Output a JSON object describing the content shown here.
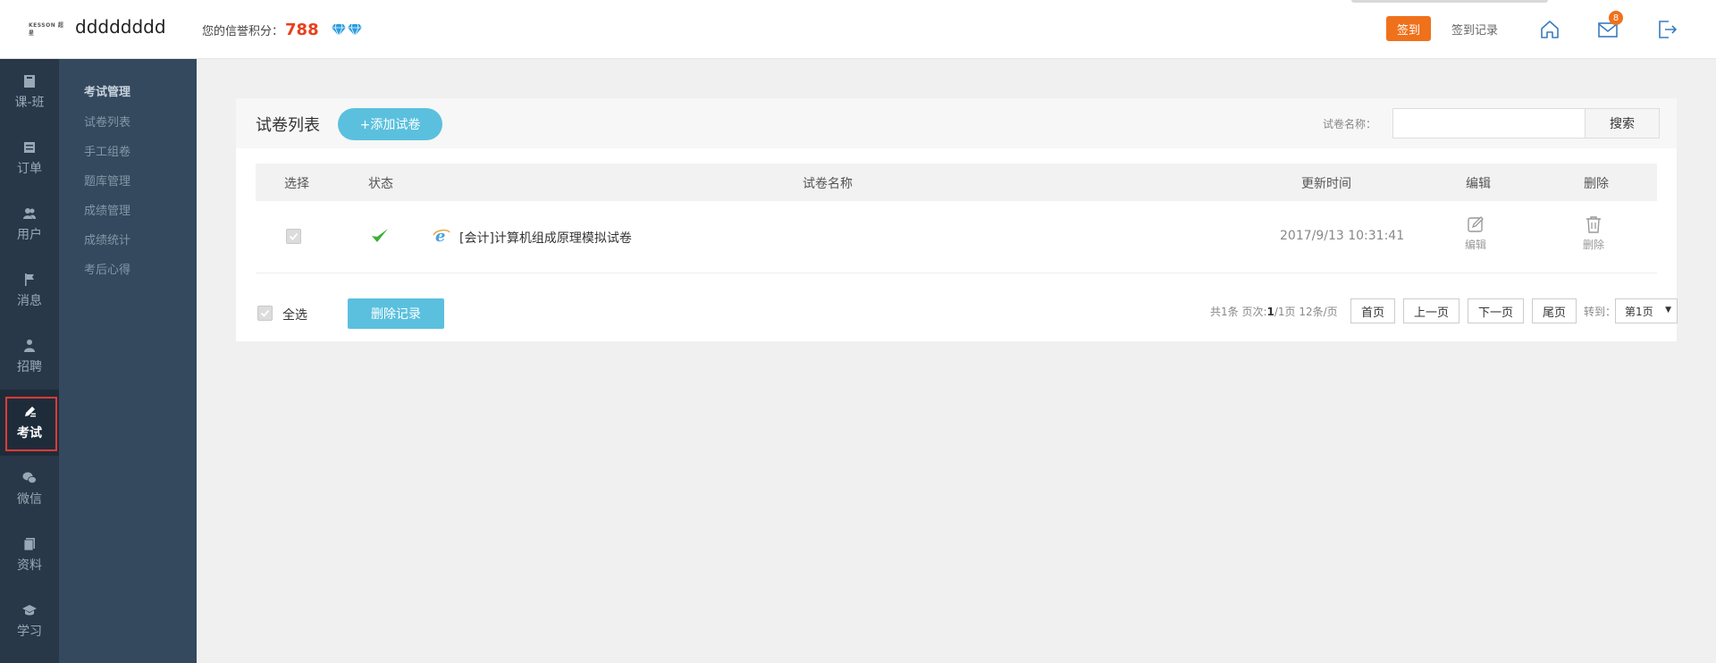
{
  "header": {
    "logo_text": "KESSON 超星",
    "username": "dddddddd",
    "credit_label": "您的信誉积分：",
    "credit_value": "788",
    "sign_label": "签到",
    "sign_record_label": "签到记录",
    "mail_badge": "8"
  },
  "rail": {
    "items": [
      {
        "label": "课-班",
        "icon": "book-icon"
      },
      {
        "label": "订单",
        "icon": "order-icon"
      },
      {
        "label": "用户",
        "icon": "users-icon"
      },
      {
        "label": "消息",
        "icon": "flag-icon"
      },
      {
        "label": "招聘",
        "icon": "recruit-icon"
      },
      {
        "label": "考试",
        "icon": "pencil-icon"
      },
      {
        "label": "微信",
        "icon": "wechat-icon"
      },
      {
        "label": "资料",
        "icon": "docs-icon"
      },
      {
        "label": "学习",
        "icon": "graduation-icon"
      }
    ],
    "active": "考试"
  },
  "subnav": {
    "title": "考试管理",
    "items": [
      "试卷列表",
      "手工组卷",
      "题库管理",
      "成绩管理",
      "成绩统计",
      "考后心得"
    ]
  },
  "panel": {
    "title": "试卷列表",
    "add_label": "+添加试卷",
    "search_label": "试卷名称：",
    "search_value": "",
    "search_button": "搜索"
  },
  "table": {
    "columns": [
      "选择",
      "状态",
      "试卷名称",
      "更新时间",
      "编辑",
      "删除"
    ],
    "rows": [
      {
        "name": "[会计]计算机组成原理模拟试卷",
        "updated": "2017/9/13 10:31:41",
        "edit_label": "编辑",
        "delete_label": "删除"
      }
    ]
  },
  "footer": {
    "select_all_label": "全选",
    "delete_records_label": "删除记录",
    "total_prefix": "共1条 页次:",
    "page_current": "1",
    "page_rest": "/1页 12条/页",
    "first": "首页",
    "prev": "上一页",
    "next": "下一页",
    "last": "尾页",
    "goto_label": "转到：",
    "goto_value": "第1页"
  },
  "colors": {
    "accent": "#5bc0de",
    "sign": "#f0711b",
    "credit": "#e8401c",
    "rail_bg": "#283848",
    "subnav_bg": "#34495e",
    "status_ok": "#3cb034"
  }
}
